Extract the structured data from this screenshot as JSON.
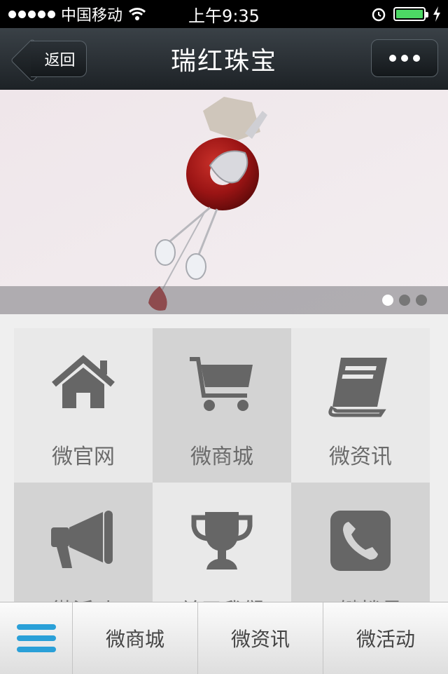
{
  "status_bar": {
    "carrier": "中国移动",
    "time": "上午9:35",
    "battery_level": 1.0,
    "icons": [
      "signal-dots-icon",
      "wifi-icon",
      "alarm-icon",
      "battery-icon",
      "charging-icon"
    ]
  },
  "nav": {
    "back_label": "返回",
    "title": "瑞红珠宝",
    "more_icon": "more-dots-icon"
  },
  "banner": {
    "image": "red-agate-pendant",
    "pages": 3,
    "active_page": 1
  },
  "grid": {
    "tiles": [
      {
        "label": "微官网",
        "icon": "home-icon"
      },
      {
        "label": "微商城",
        "icon": "cart-icon"
      },
      {
        "label": "微资讯",
        "icon": "book-icon"
      },
      {
        "label": "微活动",
        "icon": "megaphone-icon"
      },
      {
        "label": "关于我们",
        "icon": "trophy-icon"
      },
      {
        "label": "一键拨号",
        "icon": "phone-icon"
      }
    ]
  },
  "bottom_bar": {
    "menu_icon": "menu-icon",
    "items": [
      {
        "label": "微商城"
      },
      {
        "label": "微资讯"
      },
      {
        "label": "微活动"
      }
    ]
  },
  "colors": {
    "nav_bg": "#1d2226",
    "accent_blue": "#2aa0d8",
    "icon_gray": "#666666",
    "tile_light": "#e9e9e9",
    "tile_dark": "#d3d3d3"
  }
}
